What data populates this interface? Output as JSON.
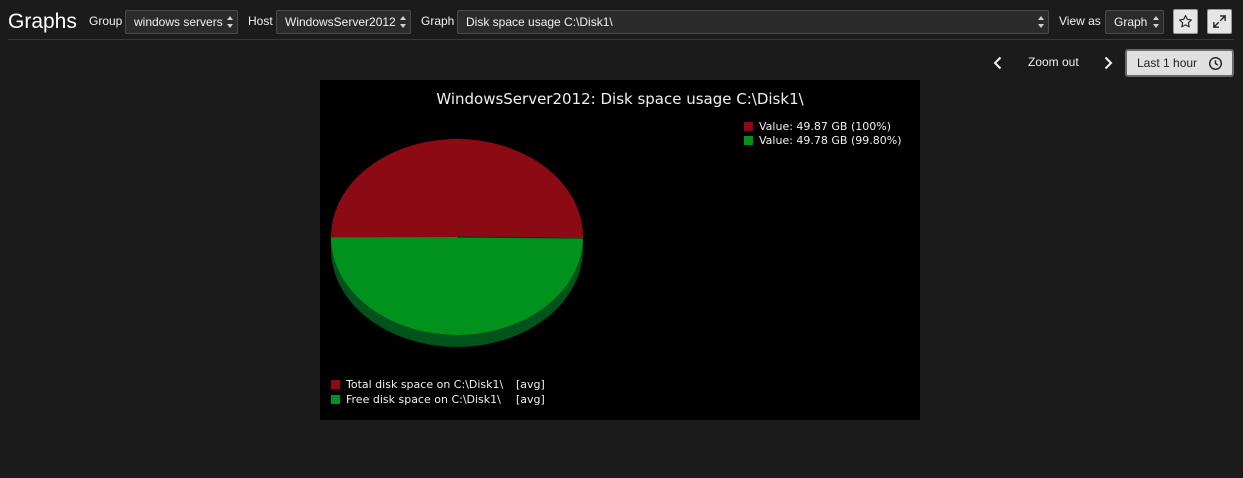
{
  "header": {
    "title": "Graphs",
    "group_label": "Group",
    "group_value": "windows servers",
    "host_label": "Host",
    "host_value": "WindowsServer2012",
    "graph_label": "Graph",
    "graph_value": "Disk space usage C:\\Disk1\\",
    "view_as_label": "View as",
    "view_as_value": "Graph",
    "favorite_icon": "star-icon",
    "fullscreen_icon": "fullscreen-icon"
  },
  "timebar": {
    "prev_icon": "chevron-left-icon",
    "zoom_out_label": "Zoom out",
    "next_icon": "chevron-right-icon",
    "period_label": "Last 1 hour",
    "period_icon": "clock-icon"
  },
  "chart_data": {
    "type": "pie",
    "title": "WindowsServer2012: Disk space usage C:\\Disk1\\",
    "slices": [
      {
        "name": "Total disk space on C:\\Disk1\\",
        "value": 49.87,
        "unit": "GB",
        "percent": 100,
        "color": "#8b0a14"
      },
      {
        "name": "Free disk space on C:\\Disk1\\",
        "value": 49.78,
        "unit": "GB",
        "percent": 99.8,
        "color": "#00921c"
      }
    ],
    "top_legend": [
      {
        "text": "Value: 49.87 GB (100%)",
        "color": "#8b0a14"
      },
      {
        "text": "Value: 49.78 GB (99.80%)",
        "color": "#00921c"
      }
    ],
    "bottom_legend": [
      {
        "name": "Total disk space on C:\\Disk1\\",
        "func": "[avg]",
        "color": "#8b0a14"
      },
      {
        "name": "Free disk space on C:\\Disk1\\",
        "func": "[avg]",
        "color": "#00921c"
      }
    ],
    "pie_shadow_color": "#00531a"
  },
  "colors": {
    "background": "#1b1b1b",
    "graph_background": "#000000",
    "total_series": "#8b0a14",
    "free_series": "#00921c"
  }
}
